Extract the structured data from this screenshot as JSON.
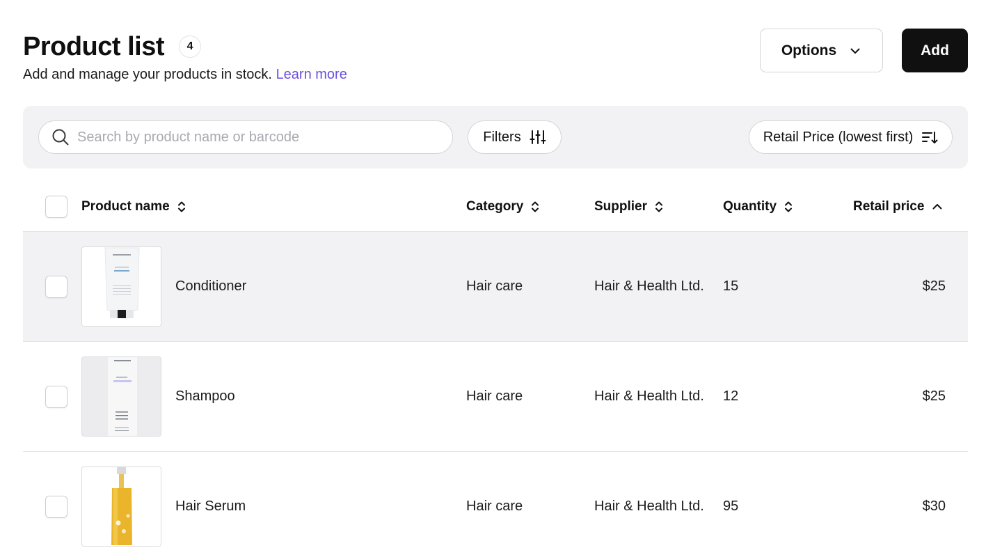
{
  "header": {
    "title": "Product list",
    "count": "4",
    "subtitle": "Add and manage your products in stock.",
    "learn_more": "Learn more",
    "options_label": "Options",
    "add_label": "Add"
  },
  "toolbar": {
    "search_placeholder": "Search by product name or barcode",
    "search_value": "",
    "filters_label": "Filters",
    "sort_label": "Retail Price (lowest first)"
  },
  "table": {
    "columns": {
      "name": "Product name",
      "category": "Category",
      "supplier": "Supplier",
      "quantity": "Quantity",
      "price": "Retail price"
    },
    "rows": [
      {
        "name": "Conditioner",
        "category": "Hair care",
        "supplier": "Hair & Health Ltd.",
        "quantity": "15",
        "price": "$25"
      },
      {
        "name": "Shampoo",
        "category": "Hair care",
        "supplier": "Hair & Health Ltd.",
        "quantity": "12",
        "price": "$25"
      },
      {
        "name": "Hair Serum",
        "category": "Hair care",
        "supplier": "Hair & Health Ltd.",
        "quantity": "95",
        "price": "$30"
      }
    ]
  },
  "colors": {
    "accent_link": "#6b4fe0",
    "primary_button": "#101010",
    "toolbar_bg": "#f2f2f4",
    "highlight_row": "#f2f2f4"
  },
  "icons": [
    "search-icon",
    "chevron-down-icon",
    "sliders-icon",
    "sort-descending-icon",
    "sort-toggle-icon",
    "sort-ascending-icon"
  ]
}
